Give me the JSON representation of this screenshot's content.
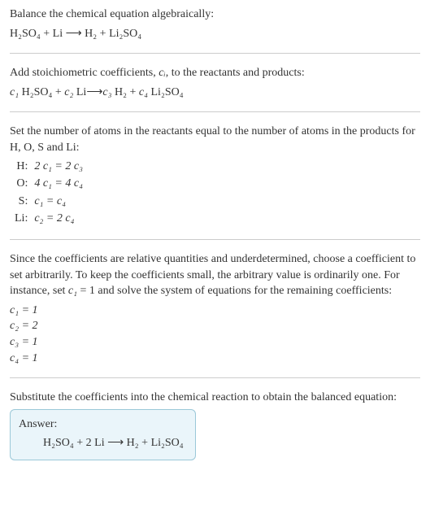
{
  "section1": {
    "title": "Balance the chemical equation algebraically:",
    "unbalanced": "H₂SO₄ + Li ⟶ H₂ + Li₂SO₄"
  },
  "section2": {
    "title_pre": "Add stoichiometric coefficients, ",
    "title_ci": "cᵢ",
    "title_post": ", to the reactants and products:",
    "eq_c1": "c₁",
    "species1": "H₂SO₄",
    "plus": " + ",
    "eq_c2": "c₂",
    "species2": "Li",
    "arrow": " ⟶ ",
    "eq_c3": "c₃",
    "species3": "H₂",
    "eq_c4": "c₄",
    "species4": "Li₂SO₄"
  },
  "section3": {
    "title": "Set the number of atoms in the reactants equal to the number of atoms in the products for H, O, S and Li:",
    "rows": [
      {
        "el": "H:",
        "eq": "2 c₁ = 2 c₃"
      },
      {
        "el": "O:",
        "eq": "4 c₁ = 4 c₄"
      },
      {
        "el": "S:",
        "eq": "c₁ = c₄"
      },
      {
        "el": "Li:",
        "eq": "c₂ = 2 c₄"
      }
    ]
  },
  "section4": {
    "text": "Since the coefficients are relative quantities and underdetermined, choose a coefficient to set arbitrarily. To keep the coefficients small, the arbitrary value is ordinarily one. For instance, set c₁ = 1 and solve the system of equations for the remaining coefficients:",
    "lines": [
      "c₁ = 1",
      "c₂ = 2",
      "c₃ = 1",
      "c₄ = 1"
    ]
  },
  "section5": {
    "title": "Substitute the coefficients into the chemical reaction to obtain the balanced equation:",
    "answer_label": "Answer:",
    "balanced": "H₂SO₄ + 2 Li ⟶ H₂ + Li₂SO₄"
  }
}
